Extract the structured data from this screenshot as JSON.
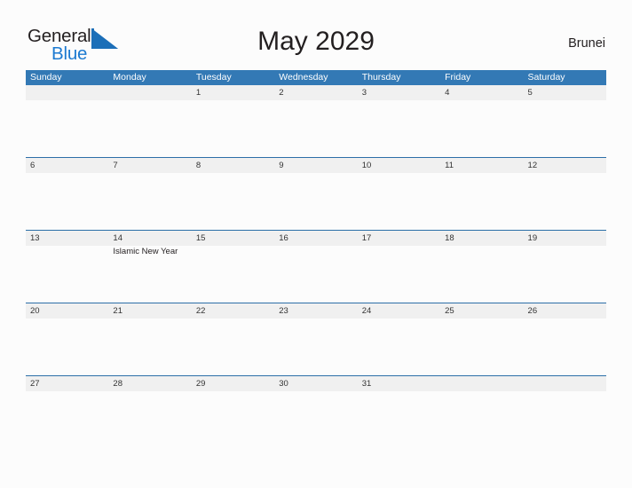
{
  "branding": {
    "word_general": "General",
    "word_blue": "Blue",
    "triangle_icon": "logo-triangle-icon",
    "accent_blue": "#1c7ad1"
  },
  "header": {
    "title": "May 2029",
    "country": "Brunei"
  },
  "colors": {
    "header_blue": "#3379b5",
    "row_divider_blue": "#2c6fa8",
    "date_band_gray": "#f0f0f0",
    "page_background": "#fcfcfc",
    "text_dark": "#231f20"
  },
  "calendar": {
    "weekdays": [
      "Sunday",
      "Monday",
      "Tuesday",
      "Wednesday",
      "Thursday",
      "Friday",
      "Saturday"
    ],
    "weeks": [
      {
        "days": [
          {
            "num": "",
            "event": ""
          },
          {
            "num": "",
            "event": ""
          },
          {
            "num": "1",
            "event": ""
          },
          {
            "num": "2",
            "event": ""
          },
          {
            "num": "3",
            "event": ""
          },
          {
            "num": "4",
            "event": ""
          },
          {
            "num": "5",
            "event": ""
          }
        ]
      },
      {
        "days": [
          {
            "num": "6",
            "event": ""
          },
          {
            "num": "7",
            "event": ""
          },
          {
            "num": "8",
            "event": ""
          },
          {
            "num": "9",
            "event": ""
          },
          {
            "num": "10",
            "event": ""
          },
          {
            "num": "11",
            "event": ""
          },
          {
            "num": "12",
            "event": ""
          }
        ]
      },
      {
        "days": [
          {
            "num": "13",
            "event": ""
          },
          {
            "num": "14",
            "event": "Islamic New Year"
          },
          {
            "num": "15",
            "event": ""
          },
          {
            "num": "16",
            "event": ""
          },
          {
            "num": "17",
            "event": ""
          },
          {
            "num": "18",
            "event": ""
          },
          {
            "num": "19",
            "event": ""
          }
        ]
      },
      {
        "days": [
          {
            "num": "20",
            "event": ""
          },
          {
            "num": "21",
            "event": ""
          },
          {
            "num": "22",
            "event": ""
          },
          {
            "num": "23",
            "event": ""
          },
          {
            "num": "24",
            "event": ""
          },
          {
            "num": "25",
            "event": ""
          },
          {
            "num": "26",
            "event": ""
          }
        ]
      },
      {
        "days": [
          {
            "num": "27",
            "event": ""
          },
          {
            "num": "28",
            "event": ""
          },
          {
            "num": "29",
            "event": ""
          },
          {
            "num": "30",
            "event": ""
          },
          {
            "num": "31",
            "event": ""
          },
          {
            "num": "",
            "event": ""
          },
          {
            "num": "",
            "event": ""
          }
        ]
      }
    ]
  }
}
